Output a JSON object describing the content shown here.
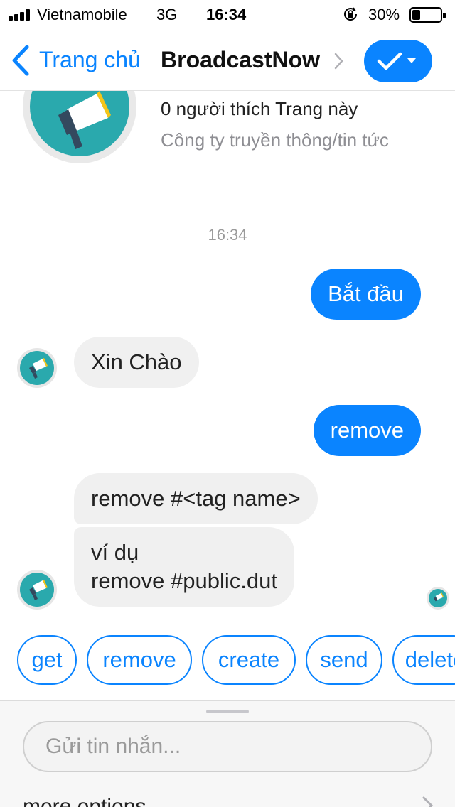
{
  "status_bar": {
    "carrier": "Vietnamobile",
    "network": "3G",
    "time": "16:34",
    "battery": "30%",
    "battery_level": 0.3,
    "icons": [
      "signal-icon",
      "orientation-lock-icon",
      "battery-icon"
    ]
  },
  "nav": {
    "back_label": "Trang chủ",
    "title": "BroadcastNow",
    "icons": [
      "back-chevron-icon",
      "chevron-right-icon",
      "checkmark-icon",
      "caret-down-icon"
    ]
  },
  "page_header": {
    "likes": "0 người thích Trang này",
    "category": "Công ty truyền thông/tin tức"
  },
  "conversation": {
    "timestamp": "16:34",
    "messages": [
      {
        "direction": "outgoing",
        "text": "Bắt đầu"
      },
      {
        "direction": "incoming",
        "text": "Xin Chào"
      },
      {
        "direction": "outgoing",
        "text": "remove"
      },
      {
        "direction": "incoming",
        "text": "remove #<tag name>"
      },
      {
        "direction": "incoming",
        "lines": [
          "ví dụ",
          "remove #public.dut"
        ]
      }
    ]
  },
  "quick_replies": [
    "get",
    "remove",
    "create",
    "send",
    "delete"
  ],
  "composer": {
    "placeholder": "Gửi tin nhắn...",
    "value": "",
    "more_options": "more options"
  },
  "colors": {
    "accent": "#0a84ff",
    "incoming_bubble": "#f0f0f0",
    "avatar_teal": "#2aa9ad"
  }
}
